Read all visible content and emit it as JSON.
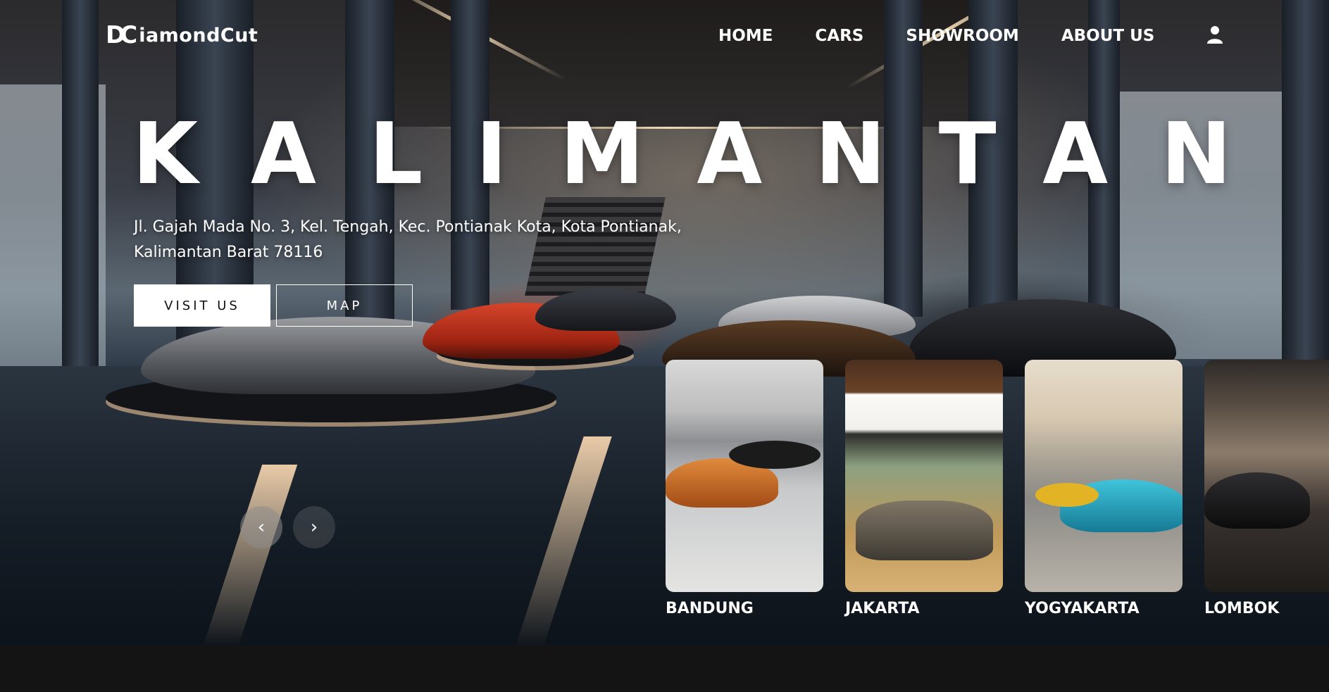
{
  "logo": {
    "mark": "DC",
    "text": "iamondCut"
  },
  "nav": {
    "items": [
      {
        "label": "HOME"
      },
      {
        "label": "CARS"
      },
      {
        "label": "SHOWROOM"
      },
      {
        "label": "ABOUT US"
      }
    ],
    "user_icon": "user-icon"
  },
  "hero": {
    "title": "KALIMANTAN",
    "address": "Jl. Gajah Mada No. 3, Kel. Tengah, Kec. Pontianak Kota, Kota Pontianak, Kalimantan Barat 78116",
    "visit_label": "VISIT US",
    "map_label": "MAP",
    "prev_icon": "‹",
    "next_icon": "›"
  },
  "showrooms": [
    {
      "label": "BANDUNG"
    },
    {
      "label": "JAKARTA"
    },
    {
      "label": "YOGYAKARTA"
    },
    {
      "label": "LOMBOK"
    }
  ],
  "colors": {
    "footer": "#141414",
    "button_bg": "#ffffff",
    "text": "#ffffff"
  }
}
